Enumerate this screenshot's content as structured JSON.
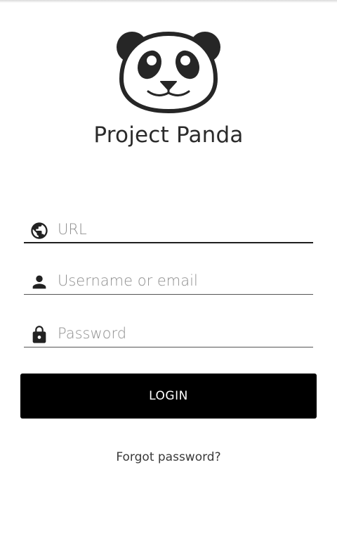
{
  "app": {
    "title": "Project Panda",
    "logo_icon": "panda-logo-icon"
  },
  "form": {
    "url": {
      "icon": "globe-icon",
      "placeholder": "URL",
      "value": ""
    },
    "username": {
      "icon": "person-icon",
      "placeholder": "Username or email",
      "value": ""
    },
    "password": {
      "icon": "lock-icon",
      "placeholder": "Password",
      "value": ""
    }
  },
  "actions": {
    "login_label": "LOGIN",
    "forgot_password_label": "Forgot password?"
  },
  "colors": {
    "background": "#ffffff",
    "button_background": "#000000",
    "button_text": "#ffffff",
    "title_text": "#2b2b2b",
    "placeholder_text": "#8f8f8f"
  }
}
